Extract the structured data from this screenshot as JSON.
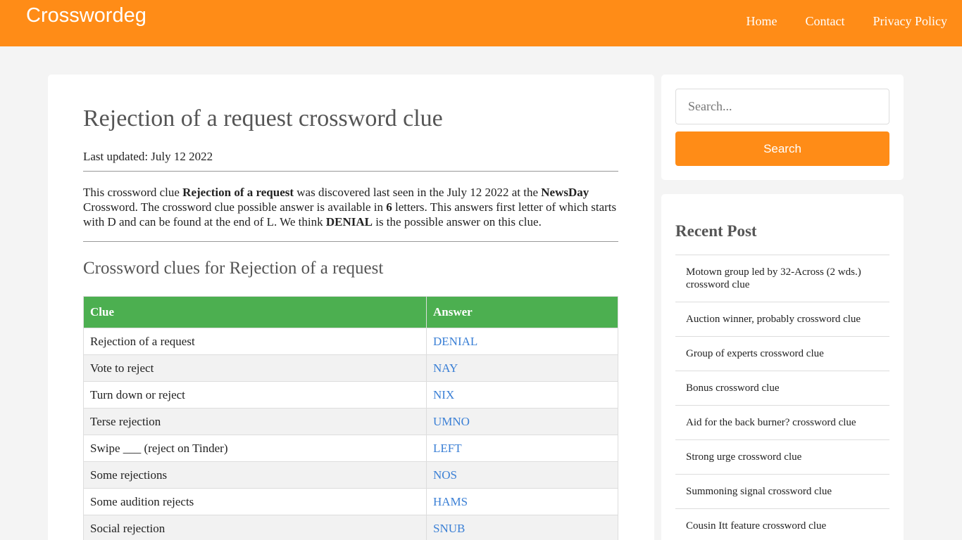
{
  "header": {
    "logo": "Crosswordeg",
    "nav": [
      "Home",
      "Contact",
      "Privacy Policy"
    ]
  },
  "article": {
    "title": "Rejection of a request crossword clue",
    "updated": "Last updated: July 12 2022",
    "desc": {
      "p1": "This crossword clue ",
      "clue": "Rejection of a request",
      "p2": " was discovered last seen in the July 12 2022 at the ",
      "source": "NewsDay",
      "p3": " Crossword. The crossword clue possible answer is available in ",
      "letters": "6",
      "p4": " letters. This answers first letter of which starts with D and can be found at the end of L. We think ",
      "answer": "DENIAL",
      "p5": " is the possible answer on this clue."
    },
    "subtitle": "Crossword clues for Rejection of a request",
    "table": {
      "headers": [
        "Clue",
        "Answer"
      ],
      "rows": [
        {
          "clue": "Rejection of a request",
          "answer": "DENIAL"
        },
        {
          "clue": "Vote to reject",
          "answer": "NAY"
        },
        {
          "clue": "Turn down or reject",
          "answer": "NIX"
        },
        {
          "clue": "Terse rejection",
          "answer": "UMNO"
        },
        {
          "clue": "Swipe ___ (reject on Tinder)",
          "answer": "LEFT"
        },
        {
          "clue": "Some rejections",
          "answer": "NOS"
        },
        {
          "clue": "Some audition rejects",
          "answer": "HAMS"
        },
        {
          "clue": "Social rejection",
          "answer": "SNUB"
        }
      ]
    }
  },
  "sidebar": {
    "search": {
      "placeholder": "Search...",
      "button": "Search"
    },
    "recent": {
      "title": "Recent Post",
      "items": [
        "Motown group led by 32-Across (2 wds.) crossword clue",
        "Auction winner, probably crossword clue",
        "Group of experts crossword clue",
        "Bonus crossword clue",
        "Aid for the back burner? crossword clue",
        "Strong urge crossword clue",
        "Summoning signal crossword clue",
        "Cousin Itt feature crossword clue"
      ]
    }
  }
}
